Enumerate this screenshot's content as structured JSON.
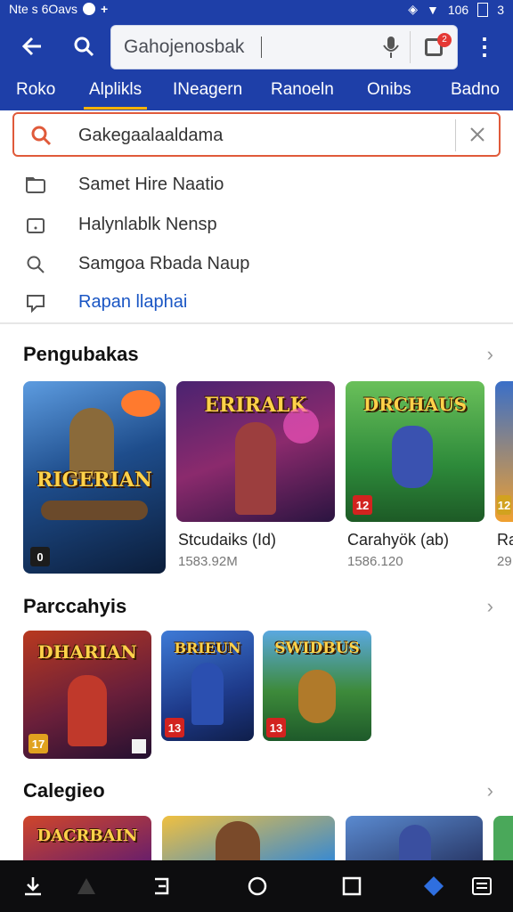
{
  "status_bar": {
    "left_text": "Nte s 6Oavs",
    "battery": "106",
    "sim": "3"
  },
  "header": {
    "search_placeholder": "Gahojenosbak",
    "notification_count": "2",
    "tabs": [
      {
        "label": "Roko"
      },
      {
        "label": "Alplikls",
        "active": true
      },
      {
        "label": "INeagern"
      },
      {
        "label": "Ranoeln"
      },
      {
        "label": "Onibs"
      },
      {
        "label": "Badno"
      }
    ]
  },
  "query": {
    "value": "Gakegaalaaldama"
  },
  "suggestions": [
    {
      "icon": "folder-icon",
      "label": "Samet Hire Naatio"
    },
    {
      "icon": "tag-icon",
      "label": "Halynlablk Nensp"
    },
    {
      "icon": "search-icon",
      "label": "Samgoa Rbada Naup"
    },
    {
      "icon": "chat-icon",
      "label": "Rapan llaphai",
      "link": true
    }
  ],
  "sections": [
    {
      "title": "Pengubakas",
      "apps": [
        {
          "art_title": "RIGERIAN",
          "badge": "0",
          "name": "",
          "size": ""
        },
        {
          "art_title": "ERIRALK",
          "badge": "",
          "name": "Stcudaiks (Id)",
          "size": "1583.92M"
        },
        {
          "art_title": "DRCHAUS",
          "badge": "12",
          "name": "Carahyök (ab)",
          "size": "1586.120"
        },
        {
          "art_title": "",
          "badge": "12",
          "name": "Ra",
          "size": "29"
        }
      ]
    },
    {
      "title": "Parccahyis",
      "apps": [
        {
          "art_title": "DHARIAN",
          "badge": "17"
        },
        {
          "art_title": "BRIEUN",
          "badge": "13"
        },
        {
          "art_title": "SWIDBUS",
          "badge": "13"
        }
      ]
    },
    {
      "title": "Calegieo",
      "apps": [
        {
          "art_title": "DACRBAIN"
        },
        {
          "art_title": ""
        },
        {
          "art_title": ""
        }
      ]
    }
  ]
}
